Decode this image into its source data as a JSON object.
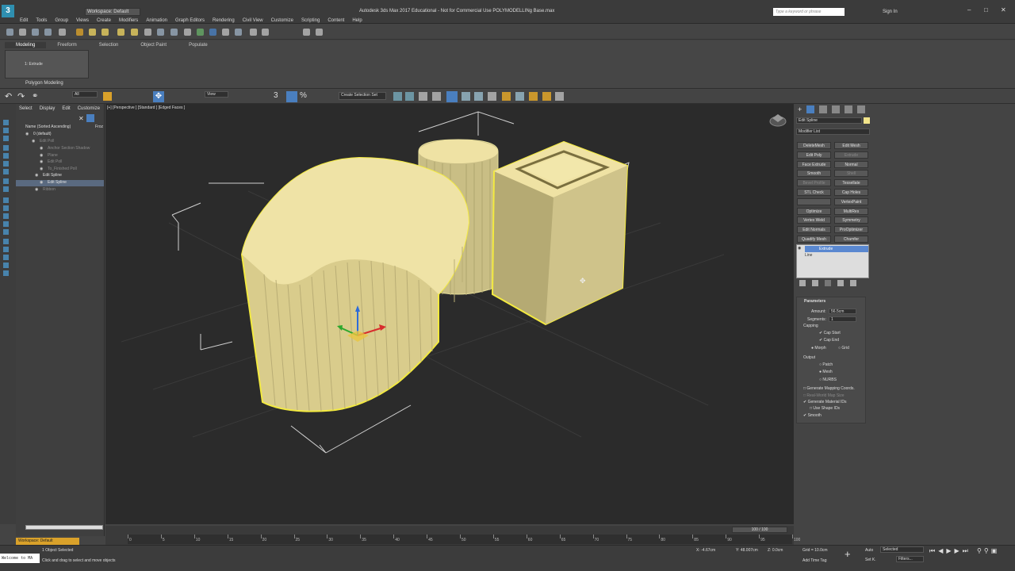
{
  "window": {
    "title": "Autodesk 3ds Max 2017 Educational - Not for Commercial Use   POLYMODELLINg Base.max",
    "workspace": "Workspace: Default",
    "search_placeholder": "Type a keyword or phrase",
    "sign_in": "Sign In"
  },
  "menu": [
    "Edit",
    "Tools",
    "Group",
    "Views",
    "Create",
    "Modifiers",
    "Animation",
    "Graph Editors",
    "Rendering",
    "Civil View",
    "Customize",
    "Scripting",
    "Content",
    "Help"
  ],
  "ribbon": {
    "tabs": [
      "Modeling",
      "Freeform",
      "Selection",
      "Object Paint",
      "Populate"
    ],
    "item": "1: Extrude",
    "panel": "Polygon Modeling"
  },
  "toolbar": {
    "filter": "All",
    "view": "View",
    "selset": "Create Selection Set"
  },
  "explorer": {
    "tabs": [
      "Select",
      "Display",
      "Edit",
      "Customize"
    ],
    "header": "Name (Sorted Ascending)",
    "header_right": "Froz",
    "rows": [
      "0 (default)",
      "Edit Poll",
      "Anchor Section Shadow",
      "Plane",
      "Edit Poll",
      "To_Finished Poll",
      "Edit Spline",
      "Edit Spline",
      "Ribbon"
    ]
  },
  "viewport": {
    "label": "[+] [Perspective ] [Standard ] [Edged Faces ]"
  },
  "command": {
    "object_name": "Edit Spline",
    "modifier_list": "Modifier List",
    "buttons": [
      [
        "DeleteMesh",
        "Edit Mesh"
      ],
      [
        "Edit Poly",
        "Extrude"
      ],
      [
        "Face Extrude",
        "Normal"
      ],
      [
        "Smooth",
        "Shell"
      ],
      [
        "Bevel Profile",
        "Tessellate"
      ],
      [
        "STL Check",
        "Cap Holes"
      ],
      [
        "",
        "VertexPaint"
      ],
      [
        "Optimize",
        "MultiRes"
      ],
      [
        "Vertex Weld",
        "Symmetry"
      ],
      [
        "Edit Normals",
        "ProOptimizer"
      ],
      [
        "Quadify Mesh",
        "Chamfer"
      ]
    ],
    "stack": [
      "Extrude",
      "Line"
    ],
    "params": {
      "title": "Parameters",
      "amount_label": "Amount:",
      "amount": "56.5cm",
      "segments_label": "Segments:",
      "segments": "1",
      "capping": "Capping",
      "cap_start": "Cap Start",
      "cap_end": "Cap End",
      "morph": "Morph",
      "grid": "Grid",
      "output": "Output",
      "patch": "Patch",
      "mesh": "Mesh",
      "nurbs": "NURBS",
      "gen_map": "Generate Mapping Coords.",
      "real_world": "Real-World Map Size",
      "gen_mat": "Generate Material IDs",
      "use_shape": "Use Shape IDs",
      "smooth": "Smooth"
    }
  },
  "timeline": {
    "frame": "100 / 100",
    "ticks": [
      "0",
      "5",
      "10",
      "15",
      "20",
      "25",
      "30",
      "35",
      "40",
      "45",
      "50",
      "55",
      "60",
      "65",
      "70",
      "75",
      "80",
      "85",
      "90",
      "95",
      "100"
    ]
  },
  "status": {
    "workspace": "Workspace: Default",
    "selected": "1 Object Selected",
    "prompt": "Click and drag to select and move objects",
    "welcome": "Welcome to MA",
    "x": "X: -4.67cm",
    "y": "Y: 48.007cm",
    "z": "Z: 0.0cm",
    "grid": "Grid = 10.0cm",
    "add_time_tag": "Add Time Tag",
    "auto": "Auto",
    "setk": "Set K.",
    "selected_dd": "Selected",
    "filters": "Filters..."
  }
}
